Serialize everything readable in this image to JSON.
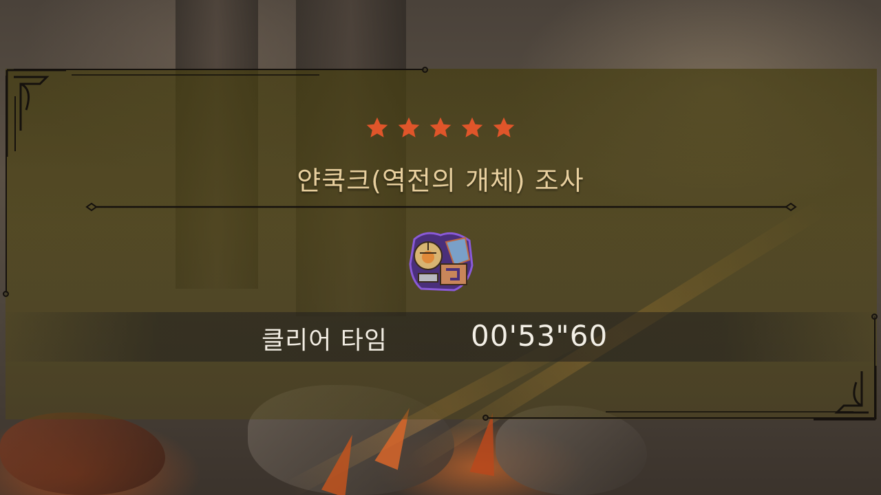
{
  "quest": {
    "rank_stars": 5,
    "title": "얀쿡크(역전의 개체) 조사",
    "monster_icon": "yian-kut-ku-icon"
  },
  "result": {
    "clear_time_label": "클리어 타임",
    "clear_time_value": "00'53\"60"
  },
  "colors": {
    "star": "#e0552a",
    "title_text": "#e8cf9e",
    "panel_tint": "#5a5018",
    "frame": "#15110d",
    "time_text": "#f3efe6"
  }
}
